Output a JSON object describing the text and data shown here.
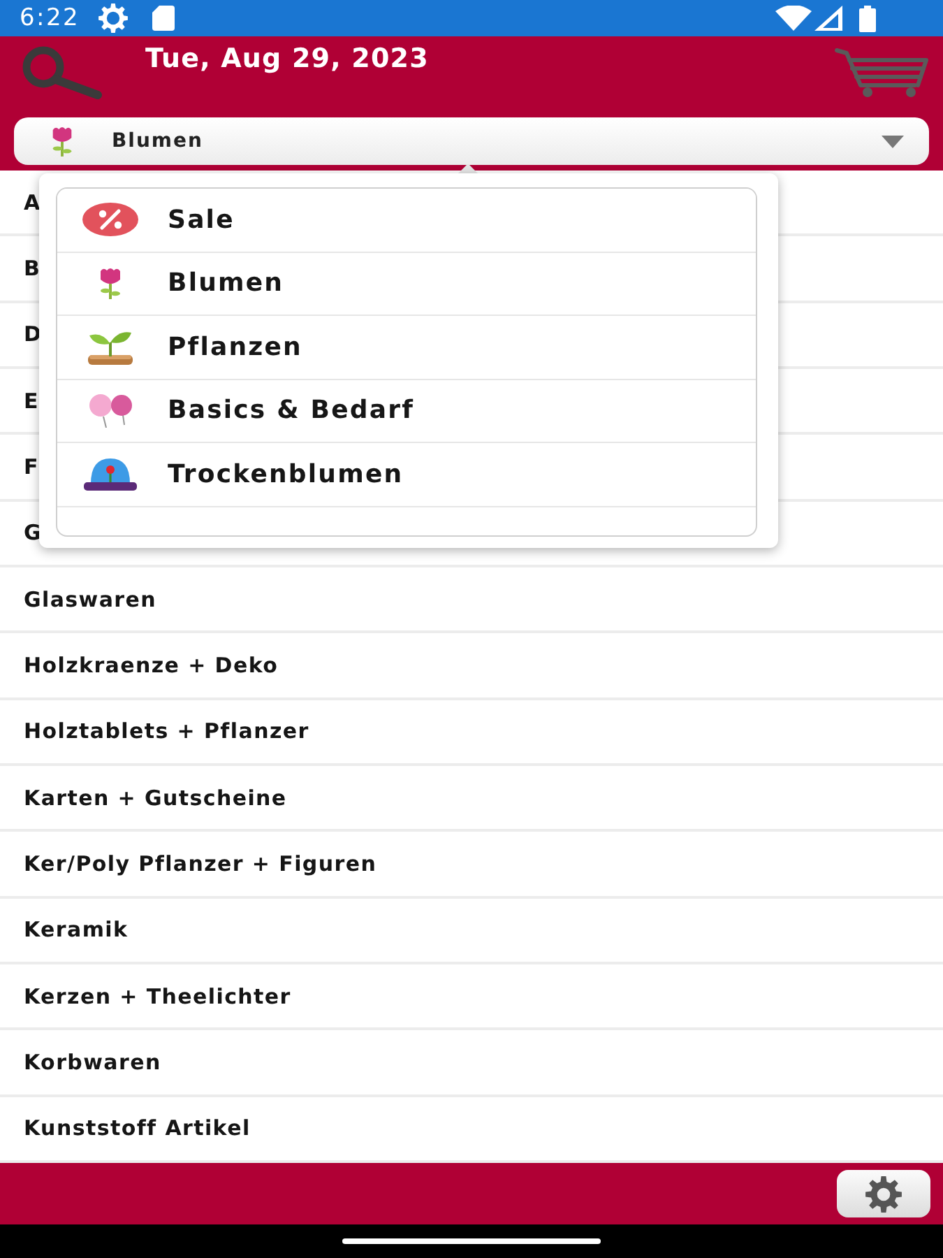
{
  "status_bar": {
    "time": "6:22"
  },
  "header": {
    "date": "Tue, Aug 29, 2023"
  },
  "category_select": {
    "value": "Blumen",
    "expanded": true
  },
  "category_options": [
    "Sale",
    "Blumen",
    "Pflanzen",
    "Basics & Bedarf",
    "Trockenblumen"
  ],
  "category_list": [
    "A",
    "B",
    "D",
    "E",
    "F",
    "G",
    "Glaswaren",
    "Holzkraenze + Deko",
    "Holztablets + Pflanzer",
    "Karten + Gutscheine",
    "Ker/Poly Pflanzer + Figuren",
    "Keramik",
    "Kerzen + Theelichter",
    "Korbwaren",
    "Kunststoff Artikel"
  ]
}
